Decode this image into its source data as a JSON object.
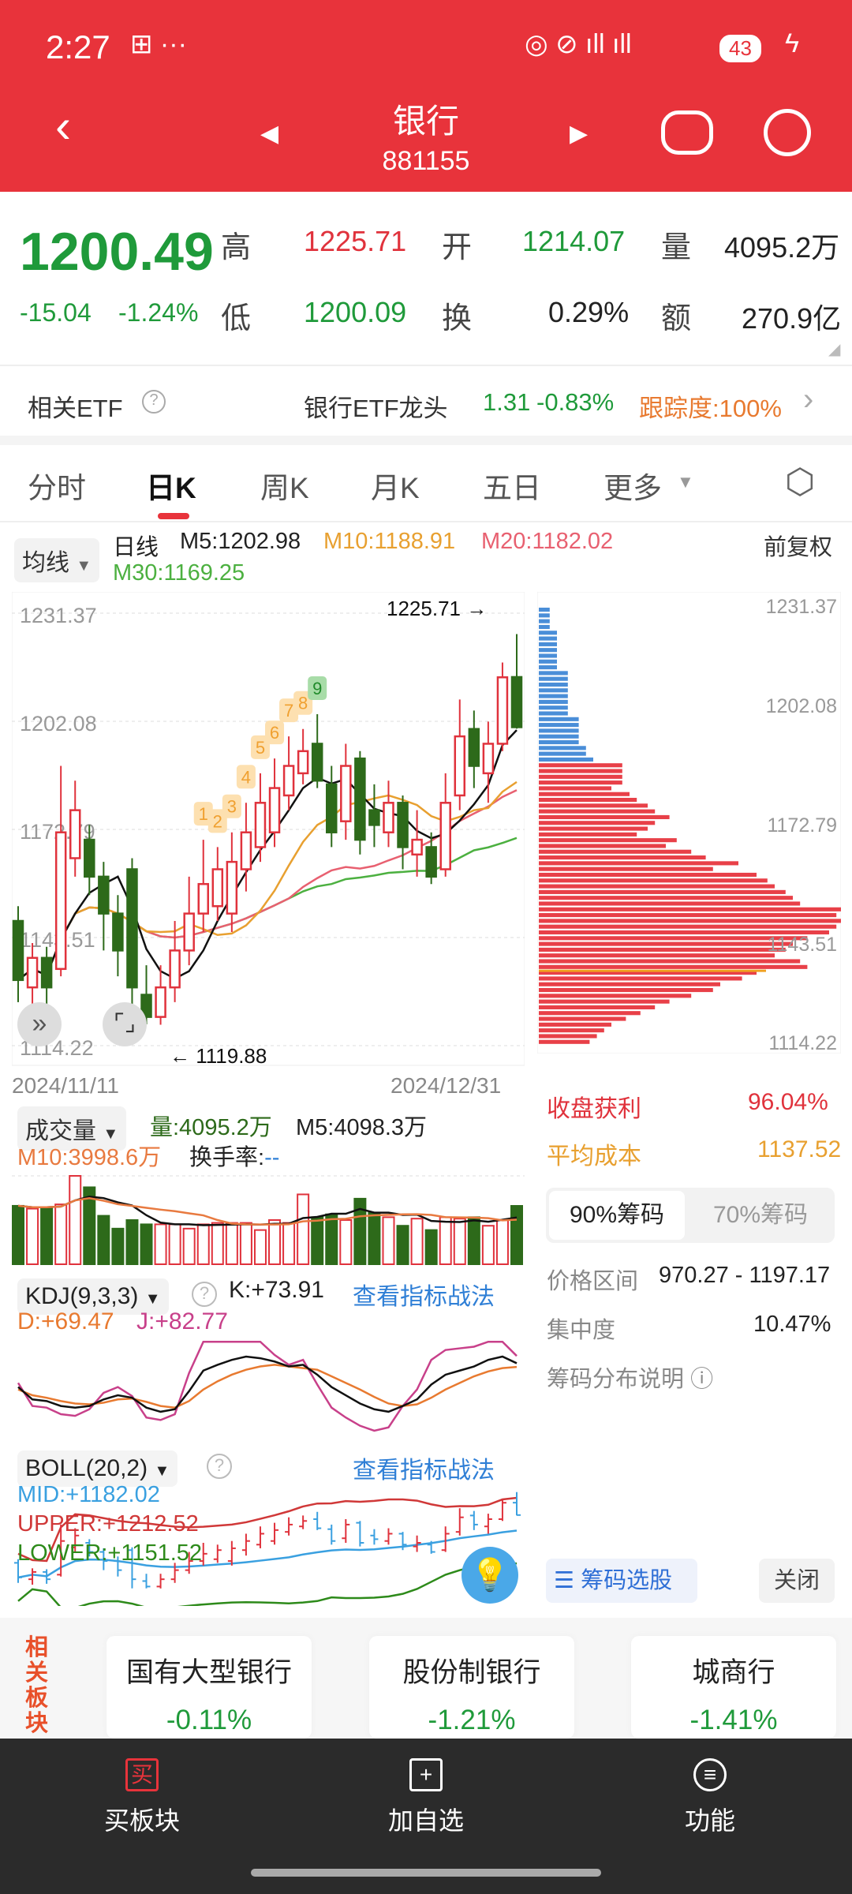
{
  "status": {
    "time": "2:27",
    "icons": [
      "notification-icon",
      "more-icon"
    ],
    "battery": "43"
  },
  "header": {
    "title": "银行",
    "code": "881155"
  },
  "quote": {
    "price": "1200.49",
    "change": "-15.04",
    "change_pct": "-1.24%",
    "high_label": "高",
    "high": "1225.71",
    "low_label": "低",
    "low": "1200.09",
    "open_label": "开",
    "open": "1214.07",
    "turnover_label": "换",
    "turnover": "0.29%",
    "vol_label": "量",
    "vol": "4095.2万",
    "amount_label": "额",
    "amount": "270.9亿"
  },
  "etf": {
    "label": "相关ETF",
    "name": "银行ETF龙头",
    "price": "1.31",
    "pct": "-0.83%",
    "track": "跟踪度:100%"
  },
  "tabs": [
    "分时",
    "日K",
    "周K",
    "月K",
    "五日",
    "更多"
  ],
  "active_tab": 1,
  "ma": {
    "selector": "均线",
    "period": "日线",
    "m5": "M5:1202.98",
    "m10": "M10:1188.91",
    "m20": "M20:1182.02",
    "m30": "M30:1169.25",
    "adjust": "前复权"
  },
  "chart_data": {
    "type": "candlestick",
    "y_ticks": [
      "1231.37",
      "1202.08",
      "1172.79",
      "1143.51",
      "1114.22"
    ],
    "ylim": [
      1114.22,
      1231.37
    ],
    "x_start": "2024/11/11",
    "x_end": "2024/12/31",
    "max_label": "1225.71",
    "min_label": "1119.88",
    "td_labels": [
      "1",
      "2",
      "3",
      "4",
      "5",
      "6",
      "7",
      "8",
      "9"
    ],
    "ohlc": [
      [
        1148,
        1152,
        1126,
        1132
      ],
      [
        1130,
        1142,
        1124,
        1138
      ],
      [
        1138,
        1141,
        1125,
        1130
      ],
      [
        1135,
        1190,
        1133,
        1172
      ],
      [
        1165,
        1186,
        1160,
        1178
      ],
      [
        1170,
        1174,
        1155,
        1160
      ],
      [
        1160,
        1164,
        1140,
        1150
      ],
      [
        1150,
        1155,
        1133,
        1140
      ],
      [
        1162,
        1165,
        1120,
        1130
      ],
      [
        1128,
        1136,
        1120,
        1122
      ],
      [
        1122,
        1136,
        1119.88,
        1130
      ],
      [
        1130,
        1148,
        1126,
        1140
      ],
      [
        1140,
        1160,
        1136,
        1150
      ],
      [
        1150,
        1170,
        1145,
        1158
      ],
      [
        1152,
        1168,
        1148,
        1162
      ],
      [
        1150,
        1172,
        1145,
        1164
      ],
      [
        1162,
        1180,
        1156,
        1172
      ],
      [
        1168,
        1188,
        1164,
        1180
      ],
      [
        1172,
        1192,
        1168,
        1184
      ],
      [
        1182,
        1198,
        1178,
        1190
      ],
      [
        1188,
        1200,
        1185,
        1194
      ],
      [
        1196,
        1204,
        1184,
        1186
      ],
      [
        1185,
        1190,
        1168,
        1172
      ],
      [
        1175,
        1196,
        1170,
        1190
      ],
      [
        1192,
        1194,
        1166,
        1170
      ],
      [
        1178,
        1185,
        1168,
        1174
      ],
      [
        1172,
        1186,
        1168,
        1180
      ],
      [
        1180,
        1182,
        1162,
        1168
      ],
      [
        1166,
        1178,
        1160,
        1170
      ],
      [
        1168,
        1172,
        1158,
        1160
      ],
      [
        1162,
        1188,
        1160,
        1180
      ],
      [
        1182,
        1208,
        1178,
        1198
      ],
      [
        1200,
        1205,
        1184,
        1190
      ],
      [
        1188,
        1202,
        1180,
        1196
      ],
      [
        1196,
        1218,
        1194,
        1214
      ],
      [
        1214.07,
        1225.71,
        1200.09,
        1200.49
      ]
    ],
    "volume": [
      4100,
      3900,
      4000,
      4200,
      6200,
      5400,
      3400,
      2500,
      3100,
      2800,
      2800,
      2800,
      2500,
      2800,
      2900,
      2900,
      2900,
      2400,
      3100,
      2900,
      4900,
      3300,
      3500,
      3100,
      4600,
      3600,
      3300,
      2700,
      3200,
      2400,
      3300,
      3200,
      3300,
      2700,
      3100,
      4095.2
    ],
    "kdj_k": [
      45,
      30,
      28,
      22,
      20,
      22,
      30,
      35,
      32,
      20,
      15,
      18,
      40,
      65,
      72,
      78,
      82,
      80,
      76,
      70,
      72,
      60,
      45,
      35,
      25,
      18,
      15,
      22,
      30,
      48,
      60,
      65,
      70,
      78,
      82,
      73.91
    ],
    "kdj_d": [
      42,
      35,
      32,
      28,
      25,
      24,
      26,
      30,
      31,
      27,
      22,
      20,
      28,
      42,
      52,
      60,
      66,
      70,
      72,
      70,
      68,
      66,
      58,
      50,
      42,
      33,
      25,
      22,
      24,
      32,
      42,
      50,
      58,
      64,
      68,
      69.47
    ],
    "kdj_j": [
      50,
      22,
      20,
      12,
      10,
      18,
      38,
      45,
      34,
      8,
      5,
      12,
      62,
      100,
      100,
      100,
      100,
      100,
      84,
      72,
      78,
      48,
      20,
      8,
      -2,
      -8,
      -4,
      22,
      42,
      78,
      90,
      92,
      94,
      100,
      100,
      82.77
    ],
    "chip_levels": [
      3,
      3,
      3,
      3,
      5,
      5,
      5,
      5,
      5,
      5,
      5,
      8,
      8,
      8,
      8,
      8,
      8,
      8,
      8,
      11,
      11,
      11,
      11,
      11,
      13,
      13,
      15,
      23,
      23,
      23,
      23,
      20,
      25,
      27,
      30,
      32,
      36,
      32,
      30,
      27,
      38,
      35,
      42,
      46,
      55,
      48,
      60,
      63,
      65,
      68,
      70,
      72,
      88,
      82,
      84,
      82,
      80,
      74,
      70,
      68,
      65,
      72,
      74,
      60,
      56,
      50,
      48,
      42,
      36,
      32,
      28,
      24,
      20,
      18,
      16,
      14
    ],
    "chip_split_index": 27,
    "chip_avg_index": 63
  },
  "volume": {
    "selector": "成交量",
    "vol": "量:4095.2万",
    "m5": "M5:4098.3万",
    "m10": "M10:3998.6万",
    "turnover": "换手率:",
    "turnover_val": "--"
  },
  "kdj": {
    "selector": "KDJ(9,3,3)",
    "k": "K:+73.91",
    "d": "D:+69.47",
    "j": "J:+82.77",
    "link": "查看指标战法"
  },
  "boll": {
    "selector": "BOLL(20,2)",
    "mid": "MID:+1182.02",
    "upper": "UPPER:+1212.52",
    "lower": "LOWER:+1151.52",
    "link": "查看指标战法"
  },
  "chips": {
    "profit_label": "收盘获利",
    "profit": "96.04%",
    "avg_label": "平均成本",
    "avg": "1137.52",
    "tab90": "90%筹码",
    "tab70": "70%筹码",
    "range_label": "价格区间",
    "range": "970.27 - 1197.17",
    "conc_label": "集中度",
    "conc": "10.47%",
    "help": "筹码分布说明",
    "select": "筹码选股",
    "close": "关闭"
  },
  "related": {
    "label": "相关板块",
    "items": [
      {
        "name": "国有大型银行",
        "pct": "-0.11%"
      },
      {
        "name": "股份制银行",
        "pct": "-1.21%"
      },
      {
        "name": "城商行",
        "pct": "-1.41%"
      }
    ]
  },
  "bottom": [
    {
      "label": "买板块",
      "icon": "buy-icon"
    },
    {
      "label": "加自选",
      "icon": "add-icon"
    },
    {
      "label": "功能",
      "icon": "menu-icon"
    }
  ],
  "colors": {
    "up": "#e0323c",
    "down": "#2d6a1a",
    "header": "#e8333b",
    "m5": "#111111",
    "m10": "#e8a030",
    "m20": "#e86070",
    "m30": "#4cb040"
  }
}
